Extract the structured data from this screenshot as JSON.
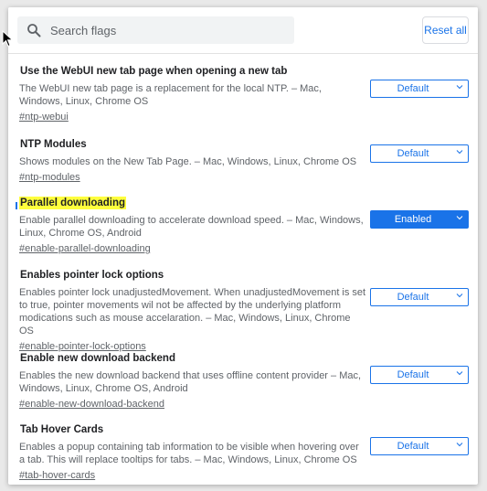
{
  "search": {
    "placeholder": "Search flags",
    "value": ""
  },
  "toolbar": {
    "reset_label": "Reset all"
  },
  "flags": [
    {
      "title": "Use the WebUI new tab page when opening a new tab",
      "description": "The WebUI new tab page is a replacement for the local NTP. – Mac, Windows, Linux, Chrome OS",
      "link": "#ntp-webui",
      "state": "Default"
    },
    {
      "title": "NTP Modules",
      "description": "Shows modules on the New Tab Page. – Mac, Windows, Linux, Chrome OS",
      "link": "#ntp-modules",
      "state": "Default"
    },
    {
      "title": "Parallel downloading",
      "description": "Enable parallel downloading to accelerate download speed. – Mac, Windows, Linux, Chrome OS, Android",
      "link": "#enable-parallel-downloading",
      "state": "Enabled",
      "highlighted": true
    },
    {
      "title": "Enables pointer lock options",
      "description": "Enables pointer lock unadjustedMovement. When unadjustedMovement is set to true, pointer movements wil not be affected by the underlying platform modications such as mouse accelaration. – Mac, Windows, Linux, Chrome OS",
      "link": "#enable-pointer-lock-options",
      "state": "Default"
    },
    {
      "title": "Enable new download backend",
      "description": "Enables the new download backend that uses offline content provider – Mac, Windows, Linux, Chrome OS, Android",
      "link": "#enable-new-download-backend",
      "state": "Default"
    },
    {
      "title": "Tab Hover Cards",
      "description": "Enables a popup containing tab information to be visible when hovering over a tab. This will replace tooltips for tabs. – Mac, Windows, Linux, Chrome OS",
      "link": "#tab-hover-cards",
      "state": "Default"
    }
  ],
  "colors": {
    "accent": "#1a73e8",
    "highlight": "#ffff3d",
    "search_bg": "#f1f3f4"
  },
  "icons": {
    "search": "search-icon",
    "dropdown": "chevron-down-icon",
    "pointer": "cursor-icon"
  }
}
